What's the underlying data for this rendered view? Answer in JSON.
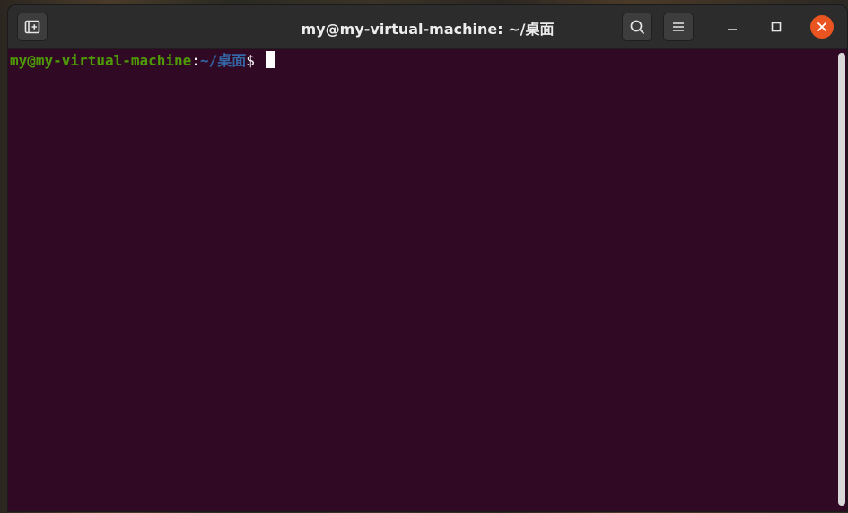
{
  "window": {
    "title": "my@my-virtual-machine: ~/桌面"
  },
  "toolbar": {
    "new_tab_icon": "new-tab-icon",
    "search_icon": "search-icon",
    "menu_icon": "hamburger-menu-icon"
  },
  "window_controls": {
    "minimize_icon": "minimize-icon",
    "maximize_icon": "maximize-icon",
    "close_icon": "close-icon",
    "close_color": "#e95420"
  },
  "terminal": {
    "background": "#300a24",
    "prompt": {
      "user_host": "my@my-virtual-machine",
      "separator": ":",
      "path": "~/桌面",
      "symbol": "$"
    }
  }
}
